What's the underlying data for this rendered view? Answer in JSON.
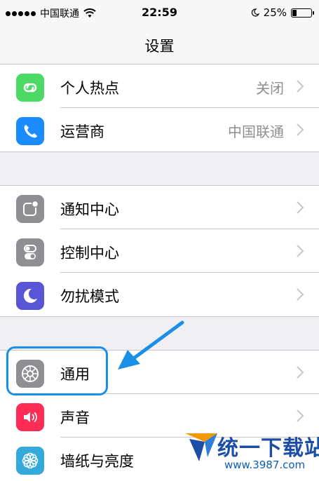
{
  "status_bar": {
    "carrier": "中国联通",
    "time": "22:59",
    "battery_percent": "25%",
    "battery_level": 0.25
  },
  "nav": {
    "title": "设置"
  },
  "groups": [
    {
      "rows": [
        {
          "label": "个人热点",
          "value": "关闭",
          "icon": "hotspot-icon",
          "color": "#4cd964"
        },
        {
          "label": "运营商",
          "value": "中国联通",
          "icon": "phone-icon",
          "color": "#1a8cff"
        }
      ]
    },
    {
      "rows": [
        {
          "label": "通知中心",
          "icon": "notification-center-icon",
          "color": "#8e8e93"
        },
        {
          "label": "控制中心",
          "icon": "control-center-icon",
          "color": "#8e8e93"
        },
        {
          "label": "勿扰模式",
          "icon": "moon-icon",
          "color": "#5856d6"
        }
      ]
    },
    {
      "rows": [
        {
          "label": "通用",
          "icon": "gear-icon",
          "color": "#8e8e93",
          "highlighted": true
        },
        {
          "label": "声音",
          "icon": "speaker-icon",
          "color": "#ff2d55"
        },
        {
          "label": "墙纸与亮度",
          "icon": "wallpaper-icon",
          "color": "#34aadc"
        }
      ]
    }
  ],
  "annotation": {
    "highlight_color": "#1b8fe6"
  },
  "watermark": {
    "name": "统一下载站",
    "url": "www.3987.com"
  }
}
